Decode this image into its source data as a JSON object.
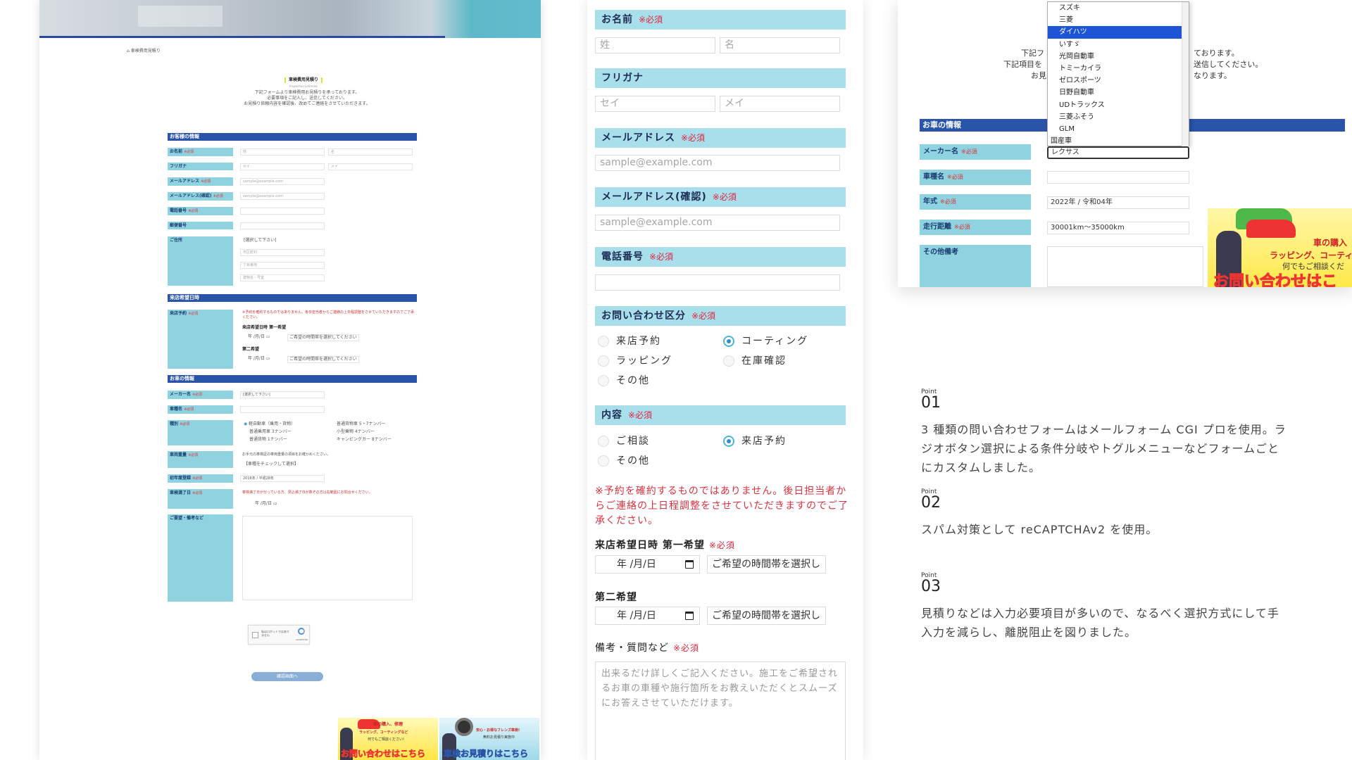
{
  "left_page": {
    "breadcrumb": "車検費用見積り",
    "title": "車検費用見積り",
    "subtitle": "Inspection Estimate",
    "intro": [
      "下記フォームより車検費用お見積りを承っております。",
      "必要事項をご記入し、送信してください。",
      "お見積り依頼内容を確認後、改めてご連絡をさせていただきます。"
    ],
    "sections": {
      "customer": "お客様の情報",
      "visit": "来店希望日時",
      "car": "お車の情報"
    },
    "labels": {
      "name": "お名前",
      "kana": "フリガナ",
      "email": "メールアドレス",
      "email_confirm": "メールアドレス(確認)",
      "phone": "電話番号",
      "zip": "郵便番号",
      "address": "ご住所",
      "visit_reserve": "来店予約",
      "maker": "メーカー名",
      "model": "車種名",
      "kind": "種別",
      "weight": "車両重量",
      "first_reg": "初年度登録",
      "expire": "車検満了日",
      "notes": "ご要望・備考など"
    },
    "req": "※必須",
    "placeholders": {
      "sei": "姓",
      "mei": "名",
      "sei_kana": "セイ",
      "mei_kana": "メイ",
      "email": "sample@example.com",
      "select": "[選択して下さい]",
      "city": "市区町村",
      "chome": "丁目番地",
      "building": "建物名・号室",
      "date": "年 /月/日",
      "time": "ご希望の時間帯を選択してください",
      "weight_select": "【車種をチェックして選択】",
      "first_reg_value": "2016年 / 平成28年"
    },
    "visit_note": "※予約を確約するものではありません。後日担当者からご連絡の上日程調整をさせていただきますのでご了承ください。",
    "visit_first": "来店希望日時 第一希望",
    "visit_second": "第二希望",
    "kinds": [
      "軽自動車（乗用・貨物）",
      "普通乗用車 3ナンバー",
      "普通貨物 1ナンバー",
      "普通貨物車 5・7ナンバー",
      "小型乗物 4ナンバー",
      "キャンピングカー 8ナンバー"
    ],
    "weight_note": "お手元の車検証の車両重量の項目をお確かめください。",
    "expire_note": "車検満了日が分っている方、見込満了日が数ぞの方は右範囲にお問合せください。",
    "recaptcha": "私はロボットではありません",
    "recaptcha_brand": "reCAPTCHA",
    "confirm_button": "確認画面へ"
  },
  "middle_form": {
    "name_label": "お名前",
    "kana_label": "フリガナ",
    "email_label": "メールアドレス",
    "email_confirm_label": "メールアドレス(確認)",
    "phone_label": "電話番号",
    "inquiry_label": "お問い合わせ区分",
    "content_label": "内容",
    "req": "※必須",
    "sei": "姓",
    "mei": "名",
    "sei_kana": "セイ",
    "mei_kana": "メイ",
    "email_placeholder": "sample@example.com",
    "inquiry_options": [
      "来店予約",
      "コーティング",
      "ラッピング",
      "在庫確認",
      "その他"
    ],
    "inquiry_selected": "コーティング",
    "content_options": [
      "ご相談",
      "来店予約",
      "その他"
    ],
    "content_selected": "来店予約",
    "note": "※予約を確約するものではありません。後日担当者からご連絡の上日程調整をさせていただきますのでご了承ください。",
    "first_choice": "来店希望日時 第一希望",
    "second_choice": "第二希望",
    "date_value": "年 /月/日",
    "time_placeholder": "ご希望の時間帯を選択し",
    "remarks_label": "備考・質問など",
    "remarks_placeholder": "出来るだけ詳しくご記入ください。施工をご希望されるお車の車種や施行箇所をお教えいただくとスムーズにお答えさせていただけます。"
  },
  "right_shot": {
    "text_lines": [
      "下記フ",
      "下記項目を",
      "お見"
    ],
    "text_right": [
      "ております。",
      "送信してください。",
      "なります。"
    ],
    "section": "お車の情報",
    "labels": [
      "メーカー名",
      "車種名",
      "年式",
      "走行距離",
      "その他備考"
    ],
    "req": "※必須",
    "dropdown_items": [
      "スズキ",
      "三菱",
      "ダイハツ",
      "いすゞ",
      "光岡自動車",
      "トミーカイラ",
      "ゼロスポーツ",
      "日野自動車",
      "UDトラックス",
      "三菱ふそう",
      "GLM"
    ],
    "dropdown_group": "国産車",
    "dropdown_selected": "ダイハツ",
    "current_value": "レクサス",
    "year_value": "2022年 / 令和04年",
    "mileage_value": "30001km〜35000km",
    "banner_text": [
      "車の購入",
      "ラッピング、コーティン",
      "何でもご相談くだ",
      "お問い合わせはこ"
    ]
  },
  "points": [
    {
      "label": "Point",
      "num": "01",
      "desc": "3 種類の問い合わせフォームはメールフォーム CGI プロを使用。ラジオボタン選択による条件分岐やトグルメニューなどフォームごとにカスタムしました。"
    },
    {
      "label": "Point",
      "num": "02",
      "desc": "スパム対策として reCAPTCHAv2 を使用。"
    },
    {
      "label": "Point",
      "num": "03",
      "desc": "見積りなどは入力必要項目が多いので、なるべく選択方式にして手入力を減らし、離脱阻止を図りました。"
    }
  ],
  "banners": {
    "left": [
      "車の購入、修理",
      "ラッピング、コーティングなど",
      "何でもご相談ください!",
      "お問い合わせはこちら"
    ],
    "right": [
      "安心・お得なフレンズ車検!",
      "無料お見積り実施中",
      "車検お見積りはこちら"
    ]
  },
  "colors": {
    "label_bg": "#a9dfea",
    "section_bg": "#2a54a8",
    "required": "#e0233e",
    "selected_option": "#1e55d6"
  }
}
